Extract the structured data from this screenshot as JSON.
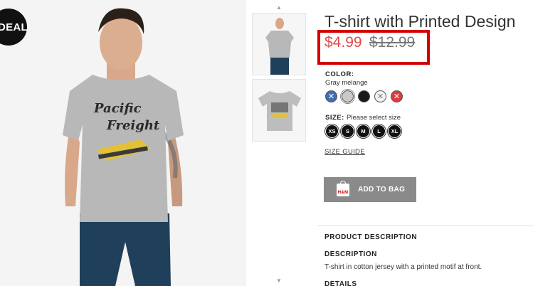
{
  "badge": {
    "label": "DEAL"
  },
  "product": {
    "title": "T-shirt with Printed Design",
    "price_now": "$4.99",
    "price_old": "$12.99"
  },
  "print": {
    "line1": "Pacific",
    "line2": "Freight"
  },
  "color": {
    "label": "COLOR:",
    "selected": "Gray melange",
    "swatches": [
      {
        "name": "blue",
        "hex": "#3f6fb3",
        "unavailable": true
      },
      {
        "name": "gray-melange",
        "hex": "#c9c9c9",
        "selected": true
      },
      {
        "name": "black",
        "hex": "#1a1a1a"
      },
      {
        "name": "white",
        "hex": "#f2f2f2",
        "unavailable": true
      },
      {
        "name": "red",
        "hex": "#e2393b",
        "unavailable": true
      }
    ]
  },
  "size": {
    "label": "SIZE:",
    "prompt": "Please select size",
    "options": [
      "XS",
      "S",
      "M",
      "L",
      "XL"
    ]
  },
  "size_guide": "SIZE GUIDE",
  "add_to_bag": {
    "label": "ADD TO BAG",
    "icon_text": "H&M"
  },
  "description": {
    "section_title": "PRODUCT DESCRIPTION",
    "heading": "DESCRIPTION",
    "text": "T-shirt in cotton jersey with a printed motif at front.",
    "details_heading": "DETAILS"
  },
  "colors": {
    "price_sale": "#e04a4a",
    "highlight_box": "#d40000",
    "button": "#8a8a8a"
  }
}
